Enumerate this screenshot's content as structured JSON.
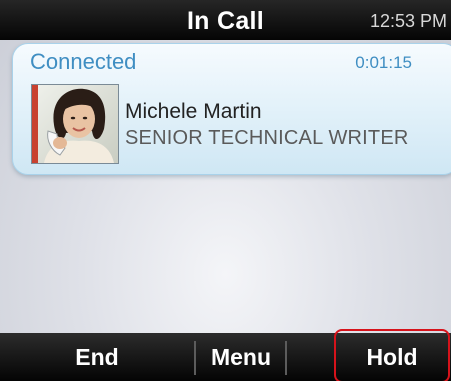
{
  "status_bar": {
    "title": "In Call",
    "time": "12:53 PM"
  },
  "call": {
    "state": "Connected",
    "duration": "0:01:15",
    "contact": {
      "name": "Michele Martin",
      "title": "SENIOR TECHNICAL WRITER",
      "avatar_icon": "contact-photo"
    }
  },
  "softkeys": {
    "end": "End",
    "menu": "Menu",
    "hold": "Hold"
  },
  "colors": {
    "accent_blue": "#3f8ec2",
    "highlight_red": "#d6131b",
    "avatar_stripe": "#c8412f"
  }
}
